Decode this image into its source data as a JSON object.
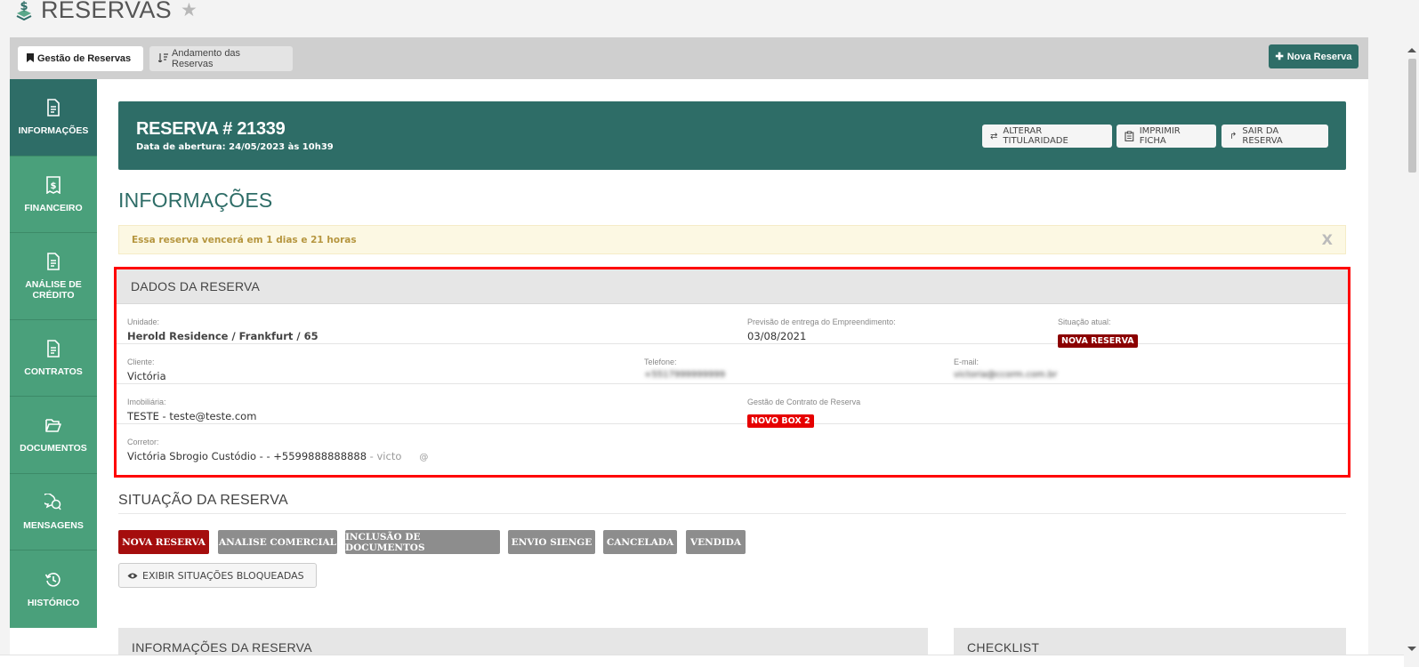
{
  "page": {
    "title": "RESERVAS"
  },
  "tabs": {
    "gestao": "Gestão de Reservas",
    "andamento": "Andamento das Reservas",
    "nova_reserva": "Nova Reserva"
  },
  "sidebar": {
    "items": [
      {
        "label": "INFORMAÇÕES",
        "icon": "document-icon",
        "active": true
      },
      {
        "label": "FINANCEIRO",
        "icon": "receipt-dollar-icon",
        "active": false
      },
      {
        "label": "ANÁLISE DE CRÉDITO",
        "icon": "document-icon",
        "active": false
      },
      {
        "label": "CONTRATOS",
        "icon": "document-icon",
        "active": false
      },
      {
        "label": "DOCUMENTOS",
        "icon": "folder-open-icon",
        "active": false
      },
      {
        "label": "MENSAGENS",
        "icon": "chat-bubbles-icon",
        "active": false
      },
      {
        "label": "HISTÓRICO",
        "icon": "history-icon",
        "active": false
      }
    ]
  },
  "reserva": {
    "title": "RESERVA # 21339",
    "subtitle": "Data de abertura: 24/05/2023 às 10h39",
    "actions": {
      "alterar": "ALTERAR TITULARIDADE",
      "imprimir": "IMPRIMIR FICHA",
      "sair": "SAIR DA RESERVA"
    }
  },
  "section_title": "INFORMAÇÕES",
  "alert": {
    "text": "Essa reserva vencerá em 1 dias e 21 horas",
    "close": "X"
  },
  "dados": {
    "header": "DADOS DA RESERVA",
    "unidade": {
      "label": "Unidade:",
      "value": "Herold Residence / Frankfurt / 65"
    },
    "previsao": {
      "label": "Previsão de entrega do Empreendimento:",
      "value": "03/08/2021"
    },
    "situacao": {
      "label": "Situação atual:",
      "value": "NOVA RESERVA"
    },
    "cliente": {
      "label": "Cliente:",
      "value": "Victória"
    },
    "telefone": {
      "label": "Telefone:",
      "value": "+5517999999999"
    },
    "email": {
      "label": "E-mail:",
      "value": "victoria@ccorm.com.br"
    },
    "imobiliaria": {
      "label": "Imobiliária:",
      "name": "TESTE",
      "sep": " - ",
      "email": "teste@teste.com"
    },
    "gestao_contrato": {
      "label": "Gestão de Contrato de Reserva",
      "value": "NOVO BOX 2"
    },
    "corretor": {
      "label": "Corretor:",
      "name": "Victória Sbrogio Custódio - - ",
      "phone": "+5599888888888",
      "extra": " - victo",
      "at": "@"
    }
  },
  "situacao_reserva": {
    "title": "SITUAÇÃO DA RESERVA",
    "steps": [
      "NOVA RESERVA",
      "ANALISE COMERCIAL",
      "INCLUSÃO DE DOCUMENTOS",
      "ENVIO SIENGE",
      "CANCELADA",
      "VENDIDA"
    ],
    "current": "NOVA RESERVA",
    "exibir_bloqueadas": "EXIBIR SITUAÇÕES BLOQUEADAS"
  },
  "cards": {
    "informacoes": "INFORMAÇÕES DA RESERVA",
    "checklist": "CHECKLIST"
  },
  "colors": {
    "brand_dark": "#2e6d67",
    "brand_sidebar": "#4aa07b",
    "status_current": "#a50d0d",
    "status_other": "#8d8d8d",
    "badge_red": "#e60000",
    "highlight_border": "#ff0000"
  }
}
